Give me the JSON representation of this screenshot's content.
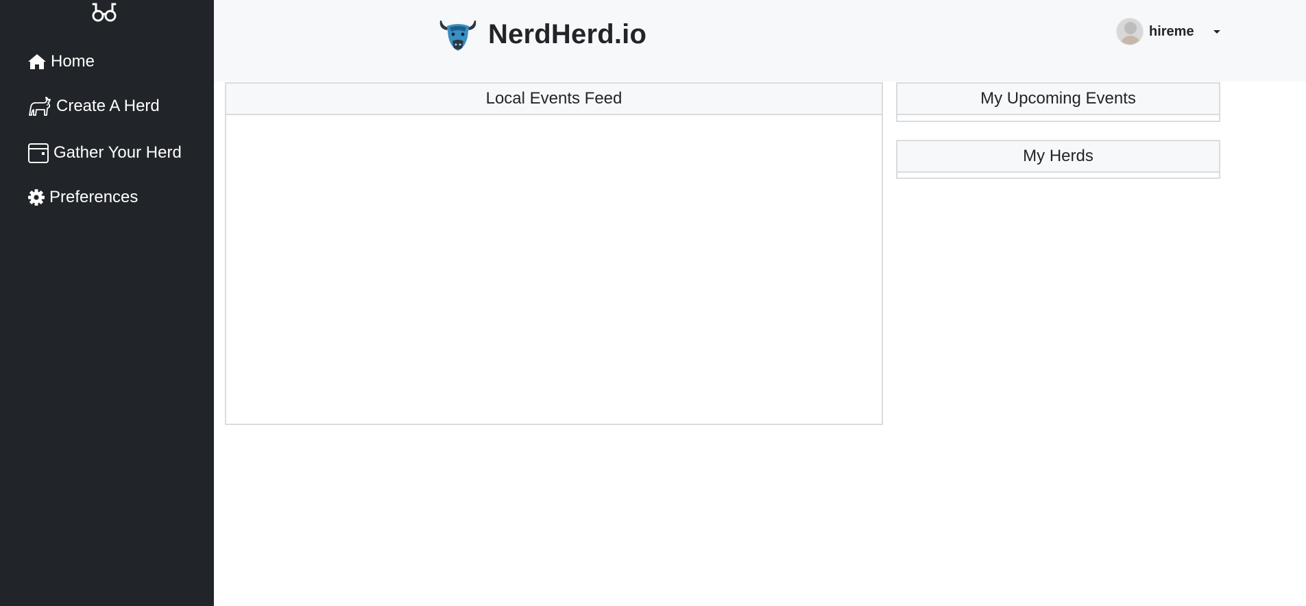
{
  "sidebar": {
    "brand_icon": "glasses-icon",
    "items": [
      {
        "label": "Home",
        "icon": "home-icon"
      },
      {
        "label": "Create A Herd",
        "icon": "bull-icon"
      },
      {
        "label": "Gather Your Herd",
        "icon": "calendar-icon"
      },
      {
        "label": "Preferences",
        "icon": "gear-icon"
      }
    ]
  },
  "header": {
    "title": "NerdHerd.io",
    "logo_icon": "bull-logo-icon",
    "user": {
      "name": "hireme"
    }
  },
  "main": {
    "feed_title": "Local Events Feed",
    "upcoming_title": "My Upcoming Events",
    "herds_title": "My Herds"
  },
  "colors": {
    "sidebar_bg": "#212529",
    "header_bg": "#f7f8f9",
    "panel_border": "#d9dcdf"
  }
}
